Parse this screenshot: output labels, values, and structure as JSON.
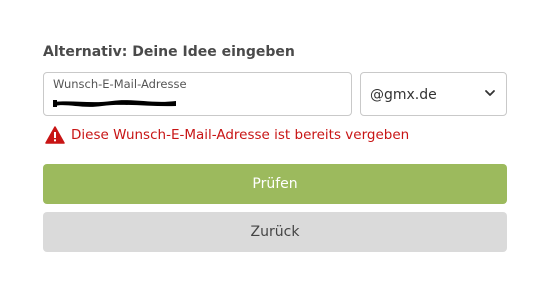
{
  "heading": "Alternativ: Deine Idee eingeben",
  "email": {
    "label": "Wunsch-E-Mail-Adresse",
    "value": ""
  },
  "domain": {
    "selected": "@gmx.de"
  },
  "error": {
    "message": "Diese Wunsch-E-Mail-Adresse ist bereits vergeben",
    "color": "#c81515"
  },
  "buttons": {
    "check_label": "Prüfen",
    "back_label": "Zurück"
  },
  "colors": {
    "primary": "#9cba5d",
    "secondary": "#dadada"
  },
  "icons": {
    "error": "warning-icon",
    "select": "chevron-down-icon"
  }
}
